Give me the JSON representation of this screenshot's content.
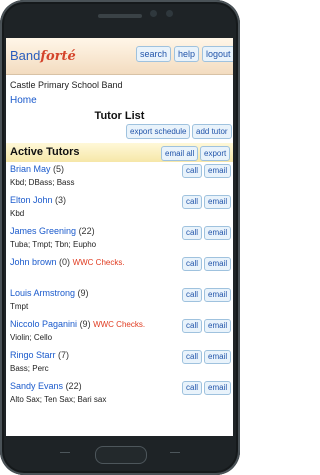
{
  "header": {
    "logo_part1": "Band",
    "logo_part2": "forté",
    "search_label": "search",
    "help_label": "help",
    "logout_label": "logout"
  },
  "school_name": "Castle Primary School Band",
  "home_link": "Home",
  "page_title": "Tutor List",
  "actions": {
    "export_schedule": "export schedule",
    "add_tutor": "add tutor"
  },
  "section": {
    "title": "Active Tutors",
    "email_all": "email all",
    "export": "export"
  },
  "tutors": [
    {
      "name": "Brian May",
      "count": "(5)",
      "warning": "",
      "instruments": "Kbd; DBass; Bass",
      "call": "call",
      "email": "email"
    },
    {
      "name": "Elton John",
      "count": "(3)",
      "warning": "",
      "instruments": "Kbd",
      "call": "call",
      "email": "email"
    },
    {
      "name": "James Greening",
      "count": "(22)",
      "warning": "",
      "instruments": "Tuba; Tmpt; Tbn; Eupho",
      "call": "call",
      "email": "email"
    },
    {
      "name": "John brown",
      "count": "(0)",
      "warning": "WWC Checks.",
      "instruments": "",
      "call": "call",
      "email": "email"
    },
    {
      "name": "Louis Armstrong",
      "count": "(9)",
      "warning": "",
      "instruments": "Tmpt",
      "call": "call",
      "email": "email"
    },
    {
      "name": "Niccolo Paganini",
      "count": "(9)",
      "warning": "WWC Checks.",
      "instruments": "Violin; Cello",
      "call": "call",
      "email": "email"
    },
    {
      "name": "Ringo Starr",
      "count": "(7)",
      "warning": "",
      "instruments": "Bass; Perc",
      "call": "call",
      "email": "email"
    },
    {
      "name": "Sandy Evans",
      "count": "(22)",
      "warning": "",
      "instruments": "Alto Sax; Ten Sax; Bari sax",
      "call": "call",
      "email": "email"
    }
  ]
}
